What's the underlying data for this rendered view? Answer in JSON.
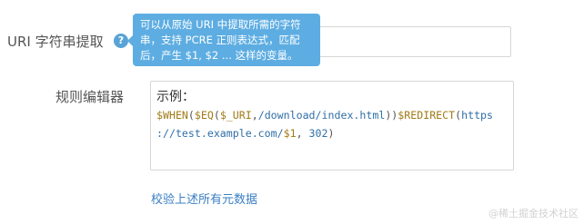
{
  "form": {
    "uri_extract": {
      "label": "URI 字符串提取",
      "help_icon": "?",
      "input_value": "",
      "tooltip": {
        "line1": "可以从原始 URI 中提取所需的字符",
        "line2": "串，支持 PCRE 正则表达式，匹配",
        "line3": "后，产生 $1, $2 ... 这样的变量。"
      }
    },
    "rule_editor": {
      "label": "规则编辑器",
      "example_label": "示例：",
      "code": {
        "t1": "$WHEN",
        "t2": "(",
        "t3": "$EQ",
        "t4": "(",
        "t5": "$_URI",
        "t6": ",",
        "t7": "/download/index.html",
        "t8": "))",
        "t9": "$REDIRECT",
        "t10": "(",
        "t11": "https",
        "t12": "://test.example.com/",
        "t13": "$1",
        "t14": ",",
        "t15": " 302",
        "t16": ")"
      }
    },
    "validate_link": "校验上述所有元数据"
  },
  "watermark": "@稀土掘金技术社区",
  "colors": {
    "tooltip_bg": "#5dade2",
    "link": "#3b7fc4",
    "code_keyword": "#a07a16",
    "code_string": "#2f6fa7"
  }
}
